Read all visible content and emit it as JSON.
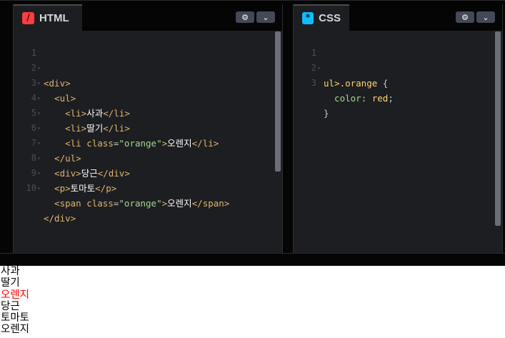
{
  "html_panel": {
    "title": "HTML",
    "icon": "html-icon",
    "settings_glyph": "⚙",
    "menu_glyph": "⌄",
    "lines": [
      {
        "n": "1",
        "fold": "▾"
      },
      {
        "n": "2",
        "fold": "▾"
      },
      {
        "n": "3",
        "fold": "▾"
      },
      {
        "n": "4",
        "fold": "▾"
      },
      {
        "n": "5",
        "fold": "▾"
      },
      {
        "n": "6",
        "fold": "▾"
      },
      {
        "n": "7",
        "fold": "▾"
      },
      {
        "n": "8",
        "fold": "▾"
      },
      {
        "n": "9",
        "fold": "▾"
      },
      {
        "n": "10",
        "fold": ""
      }
    ],
    "code": {
      "l1_open": "<div>",
      "l2_open": "  <ul>",
      "l3_open": "    <li>",
      "l3_text": "사과",
      "l3_close": "</li>",
      "l4_open": "    <li>",
      "l4_text": "딸기",
      "l4_close": "</li>",
      "l5_open": "    <li ",
      "l5_attr": "class",
      "l5_eq": "=",
      "l5_str": "\"orange\"",
      "l5_gt": ">",
      "l5_text": "오렌지",
      "l5_close": "</li>",
      "l6_close": "  </ul>",
      "l7_open": "  <div>",
      "l7_text": "당근",
      "l7_close": "</div>",
      "l8_open": "  <p>",
      "l8_text": "토마토",
      "l8_close": "</p>",
      "l9_open": "  <span ",
      "l9_attr": "class",
      "l9_eq": "=",
      "l9_str": "\"orange\"",
      "l9_gt": ">",
      "l9_text": "오렌지",
      "l9_close": "</span>",
      "l10_close": "</div>"
    }
  },
  "css_panel": {
    "title": "CSS",
    "icon": "css-icon",
    "settings_glyph": "⚙",
    "menu_glyph": "⌄",
    "lines": [
      {
        "n": "1",
        "fold": "▾"
      },
      {
        "n": "2",
        "fold": ""
      },
      {
        "n": "3",
        "fold": ""
      }
    ],
    "code": {
      "l1_sel": "ul>.orange",
      "l1_brace": " {",
      "l2_prop": "  color",
      "l2_colon": ": ",
      "l2_val": "red",
      "l2_semi": ";",
      "l3_brace": "}"
    }
  },
  "preview": {
    "items": [
      "사과",
      "딸기",
      "오렌지",
      "당근",
      "토마토",
      "오렌지"
    ]
  },
  "colors": {
    "html_accent": "#ff3c41",
    "css_accent": "#0ebeff",
    "orange_item": "#ff0000"
  }
}
